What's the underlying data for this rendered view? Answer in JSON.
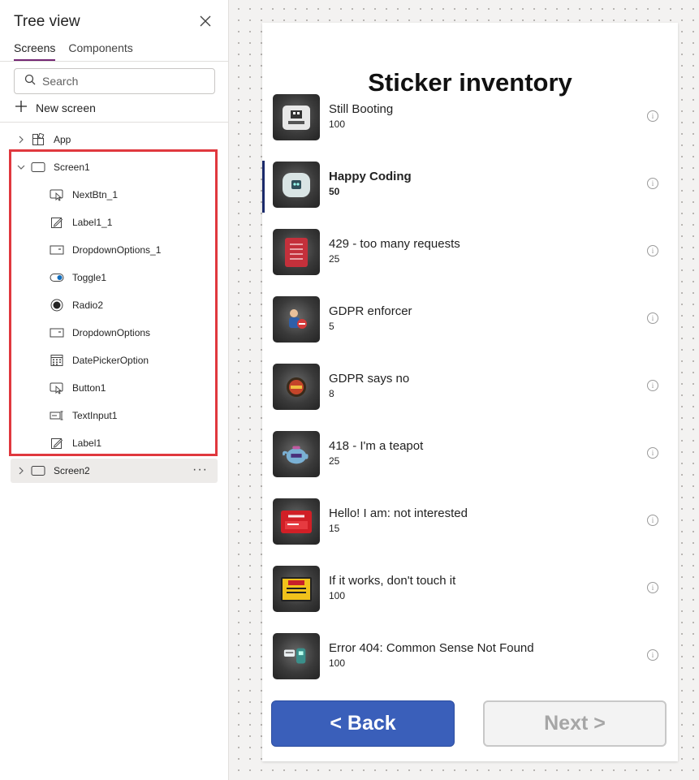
{
  "tree_panel": {
    "title": "Tree view",
    "tabs": [
      {
        "label": "Screens",
        "active": true
      },
      {
        "label": "Components",
        "active": false
      }
    ],
    "search_placeholder": "Search",
    "new_screen_label": "New screen",
    "app_label": "App",
    "screen1": {
      "label": "Screen1",
      "children": [
        {
          "label": "NextBtn_1",
          "icon": "button-icon"
        },
        {
          "label": "Label1_1",
          "icon": "label-icon"
        },
        {
          "label": "DropdownOptions_1",
          "icon": "dropdown-icon"
        },
        {
          "label": "Toggle1",
          "icon": "toggle-icon"
        },
        {
          "label": "Radio2",
          "icon": "radio-icon"
        },
        {
          "label": "DropdownOptions",
          "icon": "dropdown-icon"
        },
        {
          "label": "DatePickerOption",
          "icon": "calendar-icon"
        },
        {
          "label": "Button1",
          "icon": "button-icon"
        },
        {
          "label": "TextInput1",
          "icon": "text-input-icon"
        },
        {
          "label": "Label1",
          "icon": "label-icon"
        }
      ]
    },
    "screen2": {
      "label": "Screen2"
    },
    "highlight_color": "#e0383e",
    "active_tab_color": "#742774"
  },
  "app": {
    "title": "Sticker inventory",
    "items": [
      {
        "name": "Still Booting",
        "qty": "100",
        "selected": false
      },
      {
        "name": "Happy Coding",
        "qty": "50",
        "selected": true
      },
      {
        "name": "429 - too many requests",
        "qty": "25",
        "selected": false
      },
      {
        "name": "GDPR enforcer",
        "qty": "5",
        "selected": false
      },
      {
        "name": "GDPR says no",
        "qty": "8",
        "selected": false
      },
      {
        "name": "418 - I'm a teapot",
        "qty": "25",
        "selected": false
      },
      {
        "name": "Hello! I am: not interested",
        "qty": "15",
        "selected": false
      },
      {
        "name": "If it works, don't touch it",
        "qty": "100",
        "selected": false
      },
      {
        "name": "Error 404: Common Sense Not Found",
        "qty": "100",
        "selected": false
      }
    ],
    "back_label": "< Back",
    "next_label": "Next >",
    "back_color": "#3a5fba",
    "selected_indicator_color": "#1b2a6b"
  }
}
